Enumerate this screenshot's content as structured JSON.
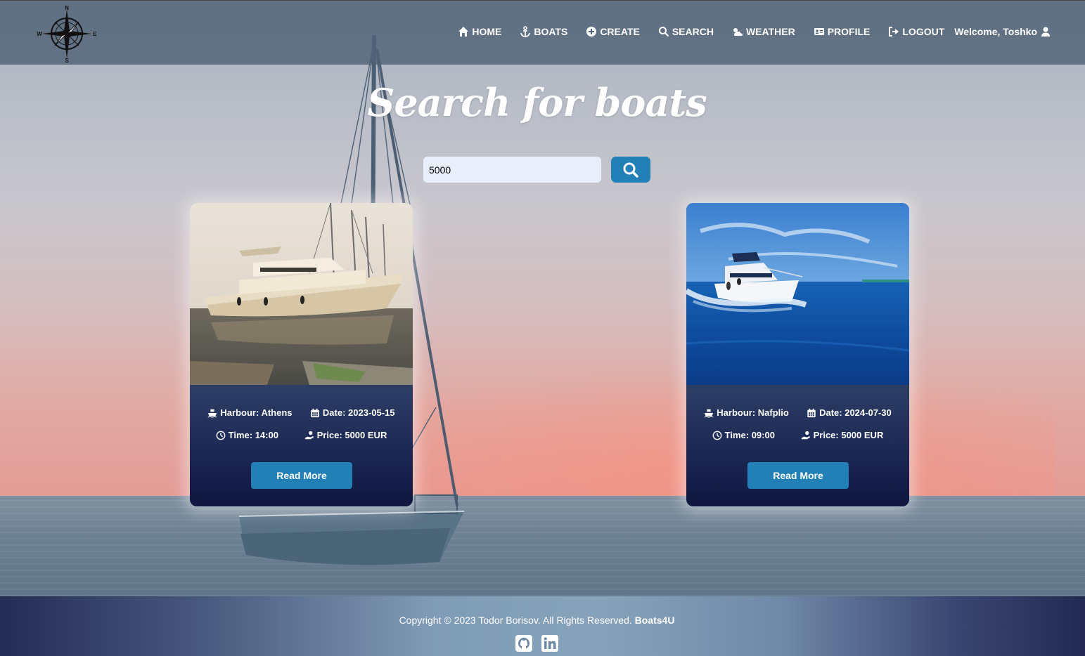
{
  "nav": {
    "items": [
      {
        "label": "HOME",
        "icon": "home-icon"
      },
      {
        "label": "BOATS",
        "icon": "anchor-icon"
      },
      {
        "label": "CREATE",
        "icon": "plus-circle-icon"
      },
      {
        "label": "SEARCH",
        "icon": "search-icon"
      },
      {
        "label": "WEATHER",
        "icon": "cloud-sun-icon"
      },
      {
        "label": "PROFILE",
        "icon": "id-card-icon"
      },
      {
        "label": "LOGOUT",
        "icon": "logout-icon"
      }
    ],
    "welcome": "Welcome, Toshko",
    "logo_letters": {
      "n": "N",
      "s": "S",
      "e": "E",
      "w": "W"
    }
  },
  "search": {
    "title": "Search for boats",
    "value": "5000"
  },
  "cards": [
    {
      "harbour": "Harbour: Athens",
      "date": "Date: 2023-05-15",
      "time": "Time: 14:00",
      "price": "Price: 5000 EUR",
      "button": "Read More"
    },
    {
      "harbour": "Harbour: Nafplio",
      "date": "Date: 2024-07-30",
      "time": "Time: 09:00",
      "price": "Price: 5000 EUR",
      "button": "Read More"
    }
  ],
  "footer": {
    "copyright": "Copyright © 2023 Todor Borisov. All Rights Reserved.",
    "brand": "Boats4U"
  },
  "colors": {
    "accent": "#2180b6",
    "navbar": "#50627 6",
    "card_bottom": "#0f1640"
  }
}
